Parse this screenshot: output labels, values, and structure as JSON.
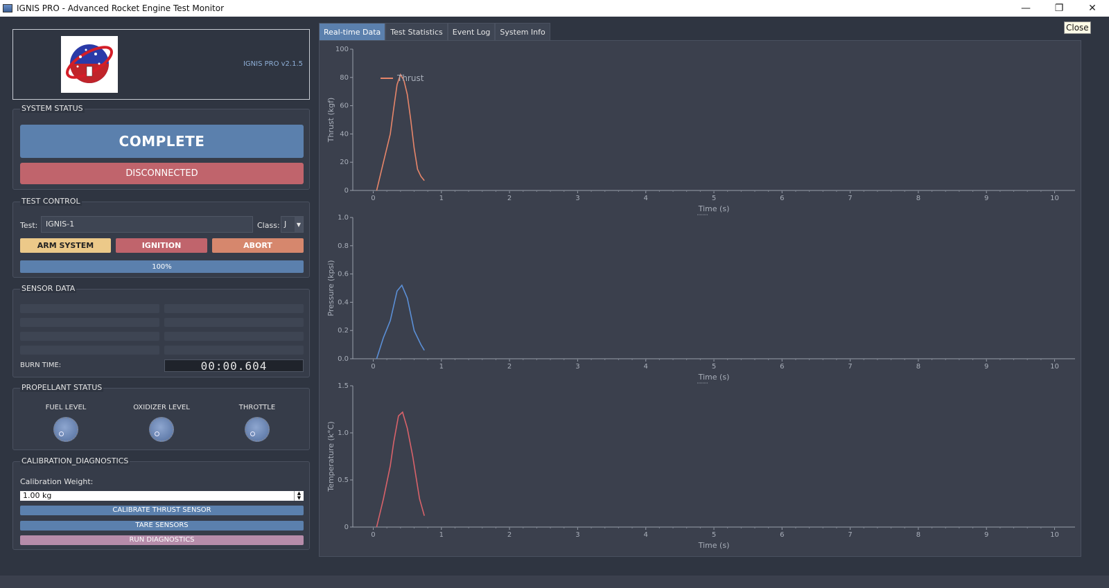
{
  "window": {
    "title": "IGNIS PRO - Advanced Rocket Engine Test Monitor",
    "close_tooltip": "Close"
  },
  "header": {
    "version": "IGNIS PRO v2.1.5"
  },
  "system_status": {
    "title": "SYSTEM STATUS",
    "state": "COMPLETE",
    "connection": "DISCONNECTED",
    "state_color": "#5b80ad",
    "connection_color": "#c0646c"
  },
  "test_control": {
    "title": "TEST CONTROL",
    "test_label": "Test:",
    "test_value": "IGNIS-1",
    "class_label": "Class:",
    "class_value": "J",
    "arm_label": "ARM SYSTEM",
    "ignition_label": "IGNITION",
    "abort_label": "ABORT",
    "progress_text": "100%",
    "progress_value": 1.0
  },
  "sensor_data": {
    "title": "SENSOR DATA",
    "burn_time_label": "BURN TIME:",
    "burn_time_value": "00:00.604"
  },
  "propellant": {
    "title": "PROPELLANT STATUS",
    "fuel_label": "FUEL LEVEL",
    "oxidizer_label": "OXIDIZER LEVEL",
    "throttle_label": "THROTTLE"
  },
  "calibration": {
    "title": "CALIBRATION_DIAGNOSTICS",
    "weight_label": "Calibration Weight:",
    "weight_value": "1.00 kg",
    "calibrate_label": "CALIBRATE THRUST SENSOR",
    "tare_label": "TARE SENSORS",
    "diagnostics_label": "RUN DIAGNOSTICS"
  },
  "tabs": [
    "Real-time Data",
    "Test Statistics",
    "Event Log",
    "System Info"
  ],
  "chart_data": [
    {
      "type": "line",
      "xlabel": "Time (s)",
      "ylabel": "Thrust (kgf)",
      "xlim": [
        -0.3,
        10.3
      ],
      "ylim": [
        0,
        100
      ],
      "xticks": [
        0,
        1,
        2,
        3,
        4,
        5,
        6,
        7,
        8,
        9,
        10
      ],
      "yticks": [
        0,
        20,
        40,
        60,
        80,
        100
      ],
      "legend": "top-left",
      "series": [
        {
          "name": "Thrust",
          "color": "#e8866a",
          "x": [
            0.05,
            0.15,
            0.25,
            0.3,
            0.35,
            0.4,
            0.45,
            0.5,
            0.55,
            0.6,
            0.65,
            0.7,
            0.75
          ],
          "y": [
            0,
            20,
            40,
            58,
            75,
            82,
            78,
            68,
            50,
            30,
            15,
            10,
            7
          ]
        }
      ]
    },
    {
      "type": "line",
      "xlabel": "Time (s)",
      "ylabel": "Pressure (kpsi)",
      "xlim": [
        -0.3,
        10.3
      ],
      "ylim": [
        0,
        1.0
      ],
      "xticks": [
        0,
        1,
        2,
        3,
        4,
        5,
        6,
        7,
        8,
        9,
        10
      ],
      "yticks": [
        0,
        0.2,
        0.4,
        0.6,
        0.8,
        1.0
      ],
      "series": [
        {
          "color": "#5b8fd6",
          "x": [
            0.05,
            0.15,
            0.25,
            0.35,
            0.42,
            0.5,
            0.6,
            0.7,
            0.75
          ],
          "y": [
            0,
            0.15,
            0.27,
            0.48,
            0.52,
            0.43,
            0.2,
            0.1,
            0.06
          ]
        }
      ]
    },
    {
      "type": "line",
      "xlabel": "Time (s)",
      "ylabel": "Temperature (k°C)",
      "xlim": [
        -0.3,
        10.3
      ],
      "ylim": [
        0,
        1.5
      ],
      "xticks": [
        0,
        1,
        2,
        3,
        4,
        5,
        6,
        7,
        8,
        9,
        10
      ],
      "yticks": [
        0,
        0.5,
        1.0,
        1.5
      ],
      "ytick_labels": [
        "0",
        "0.5",
        "1.0",
        "1.5"
      ],
      "series": [
        {
          "color": "#d9626a",
          "x": [
            0.05,
            0.15,
            0.25,
            0.3,
            0.37,
            0.43,
            0.5,
            0.58,
            0.68,
            0.75
          ],
          "y": [
            0,
            0.3,
            0.65,
            0.9,
            1.18,
            1.22,
            1.05,
            0.75,
            0.3,
            0.12
          ]
        }
      ]
    }
  ]
}
